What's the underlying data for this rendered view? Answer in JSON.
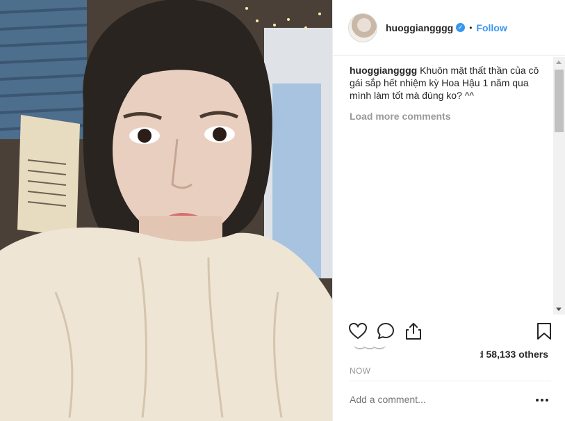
{
  "post": {
    "username": "huoggiangggg",
    "verified": true,
    "separator": "•",
    "follow_label": "Follow",
    "caption_user": "huoggiangggg",
    "caption_text": "Khuôn mặt thất thần của cô gái sắp hết nhiệm kỳ Hoa Hậu 1 năm qua mình làm tốt mà đúng ko? ^^",
    "load_more_label": "Load more comments",
    "likes_text": "d 58,133 others",
    "timestamp": "NOW",
    "comment_placeholder": "Add a comment...",
    "more_options_label": "•••"
  },
  "icons": {
    "like": "heart-icon",
    "comment": "comment-icon",
    "share": "share-icon",
    "save": "bookmark-icon",
    "more": "more-options-icon"
  },
  "colors": {
    "link": "#3897f0",
    "muted": "#999999",
    "text": "#262626",
    "border": "#efefef"
  }
}
